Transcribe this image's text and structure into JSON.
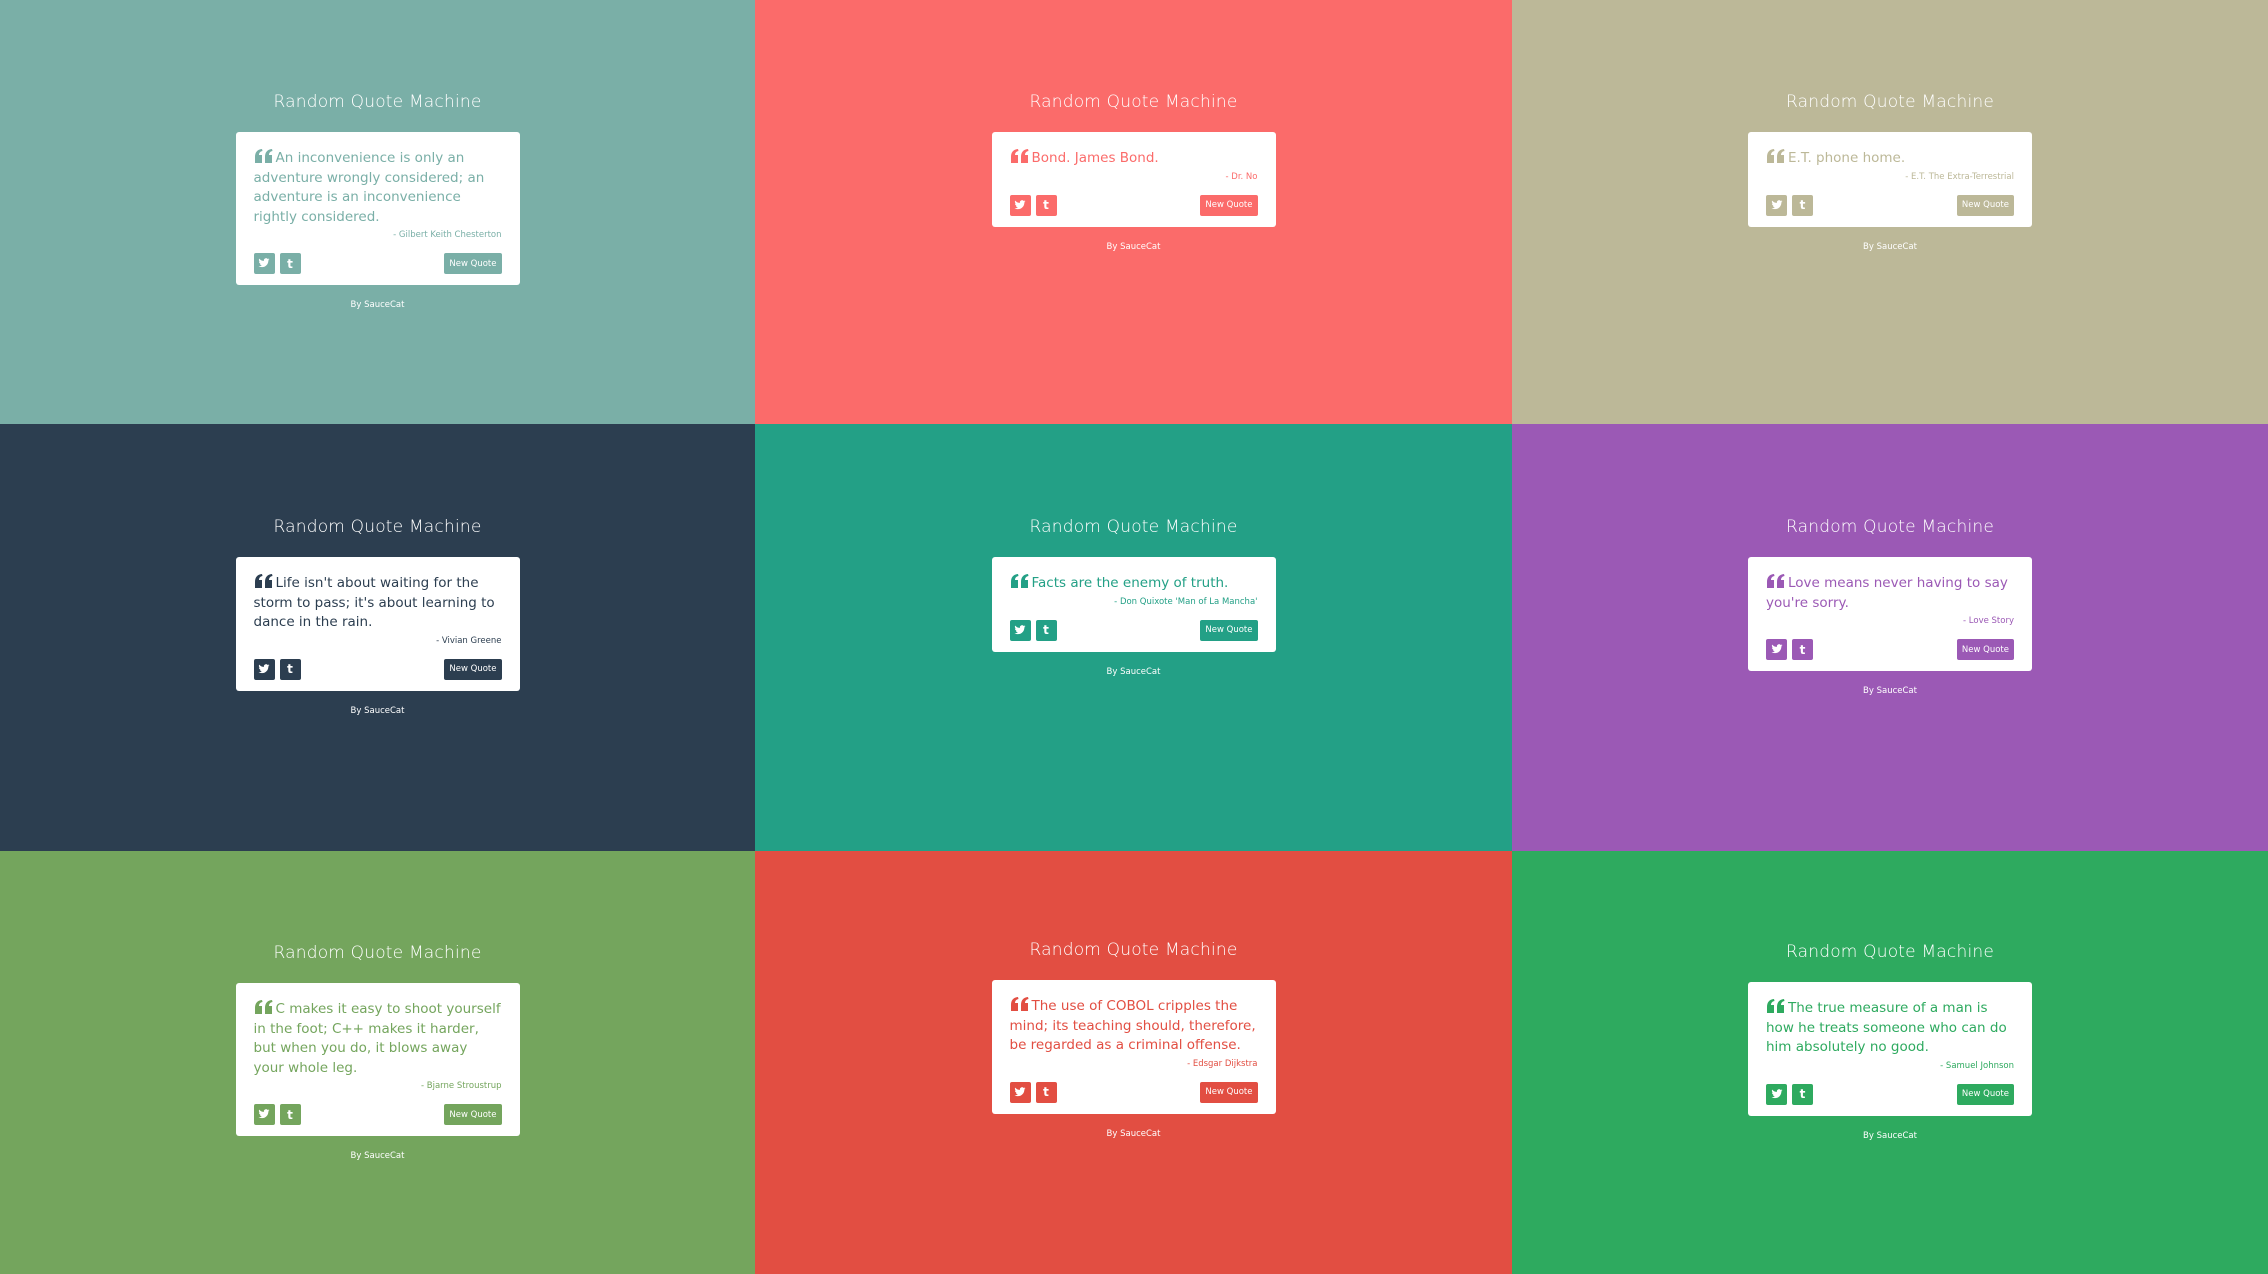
{
  "title": "Random Quote Machine",
  "new_quote_label": "New Quote",
  "credit": "By SauceCat",
  "panels": [
    {
      "bg": "#7aafa7",
      "quote": "An inconvenience is only an adventure wrongly considered; an adventure is an inconvenience rightly considered.",
      "author": "- Gilbert Keith Chesterton"
    },
    {
      "bg": "#fb6b6a",
      "quote": "Bond. James Bond.",
      "author": "- Dr. No"
    },
    {
      "bg": "#bcb898",
      "quote": "E.T. phone home.",
      "author": "- E.T. The Extra-Terrestrial"
    },
    {
      "bg": "#2c3e50",
      "quote": "Life isn't about waiting for the storm to pass; it's about learning to dance in the rain.",
      "author": "- Vivian Greene"
    },
    {
      "bg": "#23a086",
      "quote": "Facts are the enemy of truth.",
      "author": "- Don Quixote 'Man of La Mancha'"
    },
    {
      "bg": "#9b59b5",
      "quote": "Love means never having to say you're sorry.",
      "author": "- Love Story"
    },
    {
      "bg": "#74a55d",
      "quote": "C makes it easy to shoot yourself in the foot; C++ makes it harder, but when you do, it blows away your whole leg.",
      "author": "- Bjarne Stroustrup"
    },
    {
      "bg": "#e24e42",
      "quote": "The use of COBOL cripples the mind; its teaching should, therefore, be regarded as a criminal offense.",
      "author": "- Edsgar Dijkstra"
    },
    {
      "bg": "#2eaa5f",
      "quote": "The true measure of a man is how he treats someone who can do him absolutely no good.",
      "author": "- Samuel Johnson"
    }
  ]
}
